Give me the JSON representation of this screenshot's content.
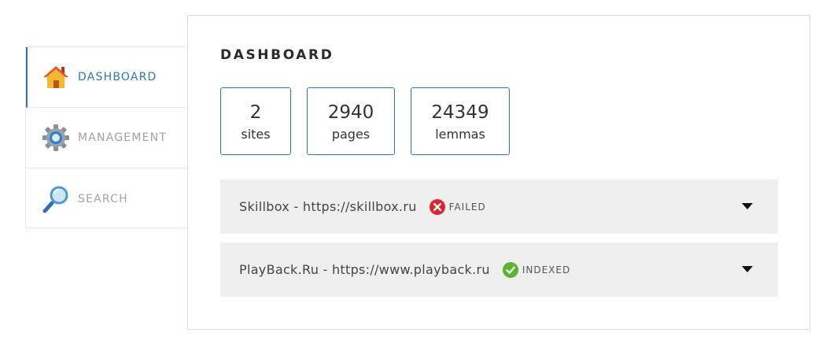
{
  "sidebar": {
    "items": [
      {
        "label": "DASHBOARD",
        "icon": "home-icon",
        "active": true
      },
      {
        "label": "MANAGEMENT",
        "icon": "gear-icon",
        "active": false
      },
      {
        "label": "SEARCH",
        "icon": "magnifier-icon",
        "active": false
      }
    ]
  },
  "main": {
    "title": "DASHBOARD",
    "stats": [
      {
        "value": "2",
        "label": "sites"
      },
      {
        "value": "2940",
        "label": "pages"
      },
      {
        "value": "24349",
        "label": "lemmas"
      }
    ],
    "sites": [
      {
        "name": "Skillbox - https://skillbox.ru",
        "status": "FAILED",
        "status_icon": "error-icon",
        "status_color": "#e0242e"
      },
      {
        "name": "PlayBack.Ru - https://www.playback.ru",
        "status": "INDEXED",
        "status_icon": "check-icon",
        "status_color": "#5cb531"
      }
    ]
  },
  "colors": {
    "accent": "#2e76b2",
    "row_bg": "#efefef"
  }
}
